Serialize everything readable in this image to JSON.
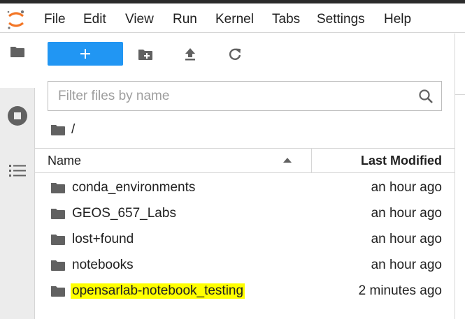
{
  "app": {
    "logo_icon": "jupyter-logo-icon",
    "accent_color": "#2196f3",
    "highlight_color": "#ffff00"
  },
  "menu": {
    "items": [
      {
        "label": "File"
      },
      {
        "label": "Edit"
      },
      {
        "label": "View"
      },
      {
        "label": "Run"
      },
      {
        "label": "Kernel"
      },
      {
        "label": "Tabs"
      },
      {
        "label": "Settings"
      },
      {
        "label": "Help"
      }
    ]
  },
  "sidebar": {
    "icons": [
      "folder-icon",
      "running-stop-icon",
      "table-of-contents-icon"
    ]
  },
  "toolbar": {
    "new_label": "+",
    "buttons": [
      "new-folder-icon",
      "upload-icon",
      "refresh-icon"
    ]
  },
  "filter": {
    "placeholder": "Filter files by name",
    "value": ""
  },
  "breadcrumb": {
    "separator": "/"
  },
  "listing": {
    "columns": {
      "name": "Name",
      "modified": "Last Modified"
    },
    "sort": "ascending",
    "rows": [
      {
        "name": "conda_environments",
        "modified": "an hour ago",
        "type": "folder",
        "highlighted": false
      },
      {
        "name": "GEOS_657_Labs",
        "modified": "an hour ago",
        "type": "folder",
        "highlighted": false
      },
      {
        "name": "lost+found",
        "modified": "an hour ago",
        "type": "folder",
        "highlighted": false
      },
      {
        "name": "notebooks",
        "modified": "an hour ago",
        "type": "folder",
        "highlighted": false
      },
      {
        "name": "opensarlab-notebook_testing",
        "modified": "2 minutes ago",
        "type": "folder",
        "highlighted": true
      }
    ]
  }
}
